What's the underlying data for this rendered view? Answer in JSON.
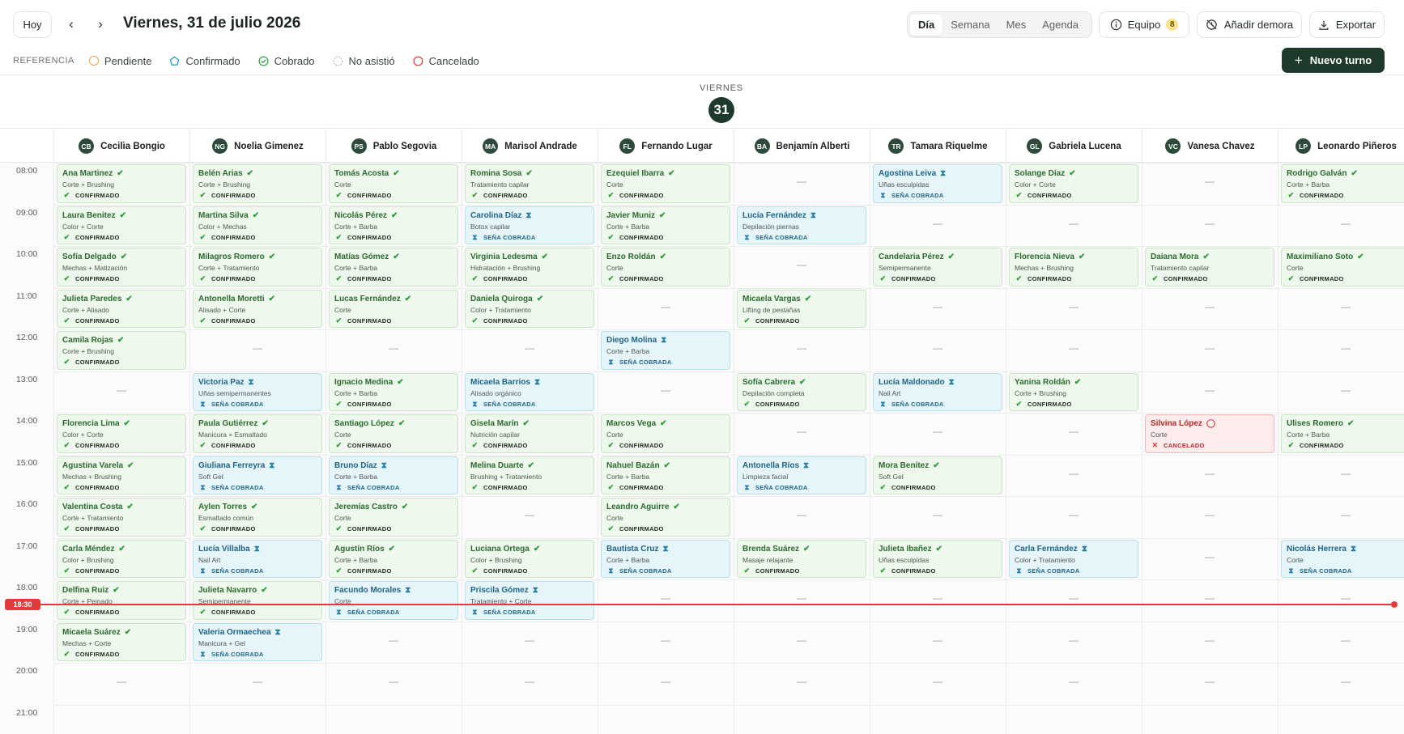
{
  "toolbar": {
    "today": "Hoy",
    "prev_icon": "‹",
    "next_icon": "›",
    "date_title": "Viernes, 31 de julio 2026",
    "views": [
      "Día",
      "Semana",
      "Mes",
      "Agenda"
    ],
    "active_view": "Día",
    "team_label": "Equipo",
    "team_count": "8",
    "delay_label": "Añadir demora",
    "export_label": "Exportar",
    "new_label": "Nuevo turno"
  },
  "legend": {
    "label": "REFERENCIA",
    "items": [
      {
        "label": "Pendiente",
        "color": "#e9a53a"
      },
      {
        "label": "Confirmado",
        "color": "#3a9bc9"
      },
      {
        "label": "Cobrado",
        "color": "#3aa350"
      },
      {
        "label": "No asistió",
        "color": "#b8bcba"
      },
      {
        "label": "Cancelado",
        "color": "#e04848"
      }
    ]
  },
  "day": {
    "name": "VIERNES",
    "number": "31"
  },
  "staff": [
    {
      "initials": "CB",
      "name": "Cecilia Bongio"
    },
    {
      "initials": "NG",
      "name": "Noelia Gimenez"
    },
    {
      "initials": "PS",
      "name": "Pablo Segovia"
    },
    {
      "initials": "MA",
      "name": "Marisol Andrade"
    },
    {
      "initials": "FL",
      "name": "Fernando Lugar"
    },
    {
      "initials": "BA",
      "name": "Benjamín Alberti"
    },
    {
      "initials": "TR",
      "name": "Tamara Riquelme"
    },
    {
      "initials": "GL",
      "name": "Gabriela Lucena"
    },
    {
      "initials": "VC",
      "name": "Vanesa Chavez"
    },
    {
      "initials": "LP",
      "name": "Leonardo Piñeros"
    }
  ],
  "hours": [
    "08:00",
    "09:00",
    "10:00",
    "11:00",
    "12:00",
    "13:00",
    "14:00",
    "15:00",
    "16:00",
    "17:00",
    "18:00",
    "19:00",
    "20:00",
    "21:00"
  ],
  "now_label": "18:30",
  "empty_mark": "—",
  "status_labels": {
    "confirmado": "CONFIRMADO",
    "sena": "SEÑA COBRADA",
    "cancelado": "CANCELADO"
  },
  "appointments": [
    {
      "col": 0,
      "row": 0,
      "s": "g",
      "name": "Ana Martinez",
      "service": "Corte + Brushing",
      "status": "CONFIRMADO"
    },
    {
      "col": 1,
      "row": 0,
      "s": "g",
      "name": "Belén Arias",
      "service": "Corte + Brushing",
      "status": "CONFIRMADO"
    },
    {
      "col": 2,
      "row": 0,
      "s": "g",
      "name": "Tomás Acosta",
      "service": "Corte",
      "status": "CONFIRMADO"
    },
    {
      "col": 3,
      "row": 0,
      "s": "g",
      "name": "Romina Sosa",
      "service": "Tratamiento capilar",
      "status": "CONFIRMADO"
    },
    {
      "col": 4,
      "row": 0,
      "s": "g",
      "name": "Ezequiel Ibarra",
      "service": "Corte",
      "status": "CONFIRMADO"
    },
    {
      "col": 6,
      "row": 0,
      "s": "b",
      "name": "Agostina Leiva",
      "service": "Uñas esculpidas",
      "status": "SEÑA COBRADA"
    },
    {
      "col": 7,
      "row": 0,
      "s": "g",
      "name": "Solange Díaz",
      "service": "Color + Corte",
      "status": "CONFIRMADO"
    },
    {
      "col": 9,
      "row": 0,
      "s": "g",
      "name": "Rodrigo Galván",
      "service": "Corte + Barba",
      "status": "CONFIRMADO"
    },
    {
      "col": 0,
      "row": 1,
      "s": "g",
      "name": "Laura Benitez",
      "service": "Color + Corte",
      "status": "CONFIRMADO"
    },
    {
      "col": 1,
      "row": 1,
      "s": "g",
      "name": "Martina Silva",
      "service": "Color + Mechas",
      "status": "CONFIRMADO"
    },
    {
      "col": 2,
      "row": 1,
      "s": "g",
      "name": "Nicolás Pérez",
      "service": "Corte + Barba",
      "status": "CONFIRMADO"
    },
    {
      "col": 3,
      "row": 1,
      "s": "b",
      "name": "Carolina Díaz",
      "service": "Botox capilar",
      "status": "SEÑA COBRADA"
    },
    {
      "col": 4,
      "row": 1,
      "s": "g",
      "name": "Javier Muniz",
      "service": "Corte + Barba",
      "status": "CONFIRMADO"
    },
    {
      "col": 5,
      "row": 1,
      "s": "b",
      "name": "Lucía Fernández",
      "service": "Depilación piernas",
      "status": "SEÑA COBRADA"
    },
    {
      "col": 0,
      "row": 2,
      "s": "g",
      "name": "Sofía Delgado",
      "service": "Mechas + Matización",
      "status": "CONFIRMADO"
    },
    {
      "col": 1,
      "row": 2,
      "s": "g",
      "name": "Milagros Romero",
      "service": "Corte + Tratamiento",
      "status": "CONFIRMADO"
    },
    {
      "col": 2,
      "row": 2,
      "s": "g",
      "name": "Matías Gómez",
      "service": "Corte + Barba",
      "status": "CONFIRMADO"
    },
    {
      "col": 3,
      "row": 2,
      "s": "g",
      "name": "Virginia Ledesma",
      "service": "Hidratación + Brushing",
      "status": "CONFIRMADO"
    },
    {
      "col": 4,
      "row": 2,
      "s": "g",
      "name": "Enzo Roldán",
      "service": "Corte",
      "status": "CONFIRMADO"
    },
    {
      "col": 6,
      "row": 2,
      "s": "g",
      "name": "Candelaria Pérez",
      "service": "Semipermanente",
      "status": "CONFIRMADO"
    },
    {
      "col": 7,
      "row": 2,
      "s": "g",
      "name": "Florencia Nieva",
      "service": "Mechas + Brushing",
      "status": "CONFIRMADO"
    },
    {
      "col": 8,
      "row": 2,
      "s": "g",
      "name": "Daiana Mora",
      "service": "Tratamiento capilar",
      "status": "CONFIRMADO"
    },
    {
      "col": 9,
      "row": 2,
      "s": "g",
      "name": "Maximiliano Soto",
      "service": "Corte",
      "status": "CONFIRMADO"
    },
    {
      "col": 0,
      "row": 3,
      "s": "g",
      "name": "Julieta Paredes",
      "service": "Corte + Alisado",
      "status": "CONFIRMADO"
    },
    {
      "col": 1,
      "row": 3,
      "s": "g",
      "name": "Antonella Moretti",
      "service": "Alisado + Corte",
      "status": "CONFIRMADO"
    },
    {
      "col": 2,
      "row": 3,
      "s": "g",
      "name": "Lucas Fernández",
      "service": "Corte",
      "status": "CONFIRMADO"
    },
    {
      "col": 3,
      "row": 3,
      "s": "g",
      "name": "Daniela Quiroga",
      "service": "Color + Tratamiento",
      "status": "CONFIRMADO"
    },
    {
      "col": 5,
      "row": 3,
      "s": "g",
      "name": "Micaela Vargas",
      "service": "Lifting de pestañas",
      "status": "CONFIRMADO"
    },
    {
      "col": 0,
      "row": 4,
      "s": "g",
      "name": "Camila Rojas",
      "service": "Corte + Brushing",
      "status": "CONFIRMADO"
    },
    {
      "col": 4,
      "row": 4,
      "s": "b",
      "name": "Diego Molina",
      "service": "Corte + Barba",
      "status": "SEÑA COBRADA"
    },
    {
      "col": 1,
      "row": 5,
      "s": "b",
      "name": "Victoria Paz",
      "service": "Uñas semipermanentes",
      "status": "SEÑA COBRADA"
    },
    {
      "col": 2,
      "row": 5,
      "s": "g",
      "name": "Ignacio Medina",
      "service": "Corte + Barba",
      "status": "CONFIRMADO"
    },
    {
      "col": 3,
      "row": 5,
      "s": "b",
      "name": "Micaela Barrios",
      "service": "Alisado orgánico",
      "status": "SEÑA COBRADA"
    },
    {
      "col": 5,
      "row": 5,
      "s": "g",
      "name": "Sofía Cabrera",
      "service": "Depilación completa",
      "status": "CONFIRMADO"
    },
    {
      "col": 6,
      "row": 5,
      "s": "b",
      "name": "Lucía Maldonado",
      "service": "Nail Art",
      "status": "SEÑA COBRADA"
    },
    {
      "col": 7,
      "row": 5,
      "s": "g",
      "name": "Yanina Roldán",
      "service": "Corte + Brushing",
      "status": "CONFIRMADO"
    },
    {
      "col": 0,
      "row": 6,
      "s": "g",
      "name": "Florencia Lima",
      "service": "Color + Corte",
      "status": "CONFIRMADO"
    },
    {
      "col": 1,
      "row": 6,
      "s": "g",
      "name": "Paula Gutiérrez",
      "service": "Manicura + Esmaltado",
      "status": "CONFIRMADO"
    },
    {
      "col": 2,
      "row": 6,
      "s": "g",
      "name": "Santiago López",
      "service": "Corte",
      "status": "CONFIRMADO"
    },
    {
      "col": 3,
      "row": 6,
      "s": "g",
      "name": "Gisela Marín",
      "service": "Nutrición capilar",
      "status": "CONFIRMADO"
    },
    {
      "col": 4,
      "row": 6,
      "s": "g",
      "name": "Marcos Vega",
      "service": "Corte",
      "status": "CONFIRMADO"
    },
    {
      "col": 8,
      "row": 6,
      "s": "r",
      "name": "Silvina López",
      "service": "Corte",
      "status": "CANCELADO"
    },
    {
      "col": 9,
      "row": 6,
      "s": "g",
      "name": "Ulises Romero",
      "service": "Corte + Barba",
      "status": "CONFIRMADO"
    },
    {
      "col": 0,
      "row": 7,
      "s": "g",
      "name": "Agustina Varela",
      "service": "Mechas + Brushing",
      "status": "CONFIRMADO"
    },
    {
      "col": 1,
      "row": 7,
      "s": "b",
      "name": "Giuliana Ferreyra",
      "service": "Soft Gel",
      "status": "SEÑA COBRADA"
    },
    {
      "col": 2,
      "row": 7,
      "s": "b",
      "name": "Bruno Díaz",
      "service": "Corte + Barba",
      "status": "SEÑA COBRADA"
    },
    {
      "col": 3,
      "row": 7,
      "s": "g",
      "name": "Melina Duarte",
      "service": "Brushing + Tratamiento",
      "status": "CONFIRMADO"
    },
    {
      "col": 4,
      "row": 7,
      "s": "g",
      "name": "Nahuel Bazán",
      "service": "Corte + Barba",
      "status": "CONFIRMADO"
    },
    {
      "col": 5,
      "row": 7,
      "s": "b",
      "name": "Antonella Ríos",
      "service": "Limpieza facial",
      "status": "SEÑA COBRADA"
    },
    {
      "col": 6,
      "row": 7,
      "s": "g",
      "name": "Mora Benítez",
      "service": "Soft Gel",
      "status": "CONFIRMADO"
    },
    {
      "col": 0,
      "row": 8,
      "s": "g",
      "name": "Valentina Costa",
      "service": "Corte + Tratamiento",
      "status": "CONFIRMADO"
    },
    {
      "col": 1,
      "row": 8,
      "s": "g",
      "name": "Aylen Torres",
      "service": "Esmaltado común",
      "status": "CONFIRMADO"
    },
    {
      "col": 2,
      "row": 8,
      "s": "g",
      "name": "Jeremías Castro",
      "service": "Corte",
      "status": "CONFIRMADO"
    },
    {
      "col": 4,
      "row": 8,
      "s": "g",
      "name": "Leandro Aguirre",
      "service": "Corte",
      "status": "CONFIRMADO"
    },
    {
      "col": 0,
      "row": 9,
      "s": "g",
      "name": "Carla Méndez",
      "service": "Color + Brushing",
      "status": "CONFIRMADO"
    },
    {
      "col": 1,
      "row": 9,
      "s": "b",
      "name": "Lucía Villalba",
      "service": "Nail Art",
      "status": "SEÑA COBRADA"
    },
    {
      "col": 2,
      "row": 9,
      "s": "g",
      "name": "Agustín Ríos",
      "service": "Corte + Barba",
      "status": "CONFIRMADO"
    },
    {
      "col": 3,
      "row": 9,
      "s": "g",
      "name": "Luciana Ortega",
      "service": "Color + Brushing",
      "status": "CONFIRMADO"
    },
    {
      "col": 4,
      "row": 9,
      "s": "b",
      "name": "Bautista Cruz",
      "service": "Corte + Barba",
      "status": "SEÑA COBRADA"
    },
    {
      "col": 5,
      "row": 9,
      "s": "g",
      "name": "Brenda Suárez",
      "service": "Masaje relajante",
      "status": "CONFIRMADO"
    },
    {
      "col": 6,
      "row": 9,
      "s": "g",
      "name": "Julieta Ibañez",
      "service": "Uñas esculpidas",
      "status": "CONFIRMADO"
    },
    {
      "col": 7,
      "row": 9,
      "s": "b",
      "name": "Carla Fernández",
      "service": "Color + Tratamiento",
      "status": "SEÑA COBRADA"
    },
    {
      "col": 9,
      "row": 9,
      "s": "b",
      "name": "Nicolás Herrera",
      "service": "Corte",
      "status": "SEÑA COBRADA"
    },
    {
      "col": 0,
      "row": 10,
      "s": "g",
      "name": "Delfina Ruiz",
      "service": "Corte + Peinado",
      "status": "CONFIRMADO"
    },
    {
      "col": 1,
      "row": 10,
      "s": "g",
      "name": "Julieta Navarro",
      "service": "Semipermanente",
      "status": "CONFIRMADO"
    },
    {
      "col": 2,
      "row": 10,
      "s": "b",
      "name": "Facundo Morales",
      "service": "Corte",
      "status": "SEÑA COBRADA"
    },
    {
      "col": 3,
      "row": 10,
      "s": "b",
      "name": "Priscila Gómez",
      "service": "Tratamiento + Corte",
      "status": "SEÑA COBRADA"
    },
    {
      "col": 0,
      "row": 11,
      "s": "g",
      "name": "Micaela Suárez",
      "service": "Mechas + Corte",
      "status": "CONFIRMADO"
    },
    {
      "col": 1,
      "row": 11,
      "s": "b",
      "name": "Valeria Ormaechea",
      "service": "Manicura + Gel",
      "status": "SEÑA COBRADA"
    }
  ]
}
